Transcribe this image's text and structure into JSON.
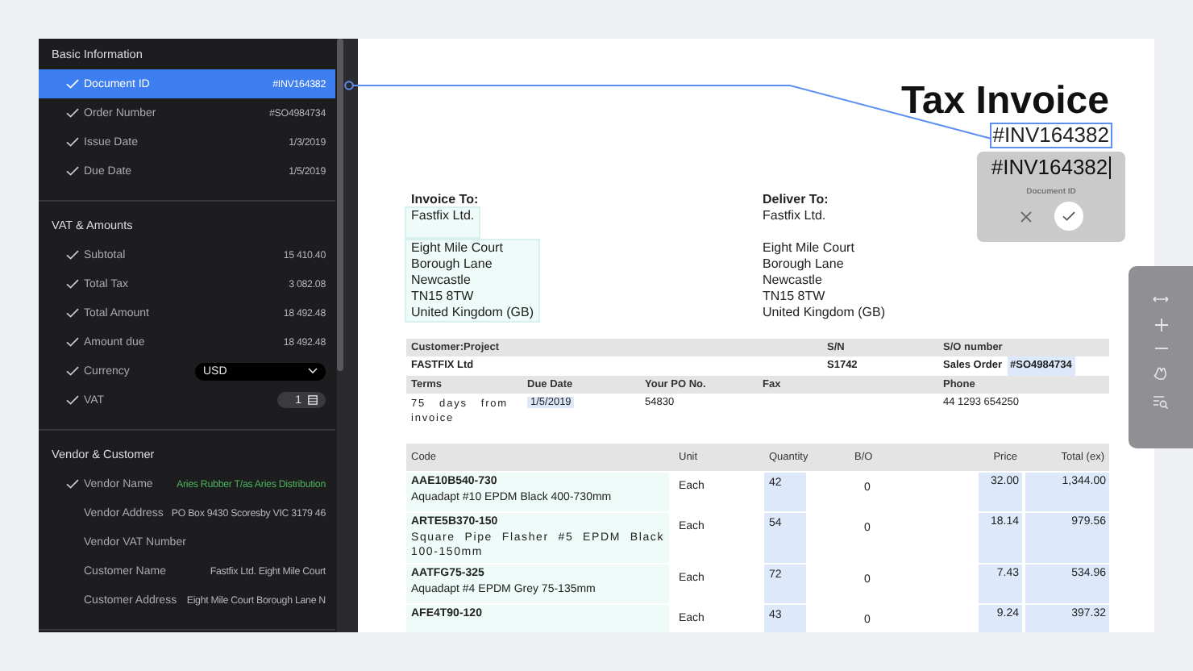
{
  "sidebar": {
    "sections": [
      {
        "title": "Basic Information",
        "fields": [
          {
            "kind": "text",
            "label": "Document ID",
            "value": "#INV164382",
            "checked": true,
            "selected": true,
            "matched": false
          },
          {
            "kind": "text",
            "label": "Order Number",
            "value": "#SO4984734",
            "checked": true,
            "selected": false,
            "matched": false
          },
          {
            "kind": "text",
            "label": "Issue Date",
            "value": "1/3/2019",
            "checked": true,
            "selected": false,
            "matched": false
          },
          {
            "kind": "text",
            "label": "Due Date",
            "value": "1/5/2019",
            "checked": true,
            "selected": false,
            "matched": false
          }
        ]
      },
      {
        "title": "VAT & Amounts",
        "fields": [
          {
            "kind": "text",
            "label": "Subtotal",
            "value": "15 410.40",
            "checked": true,
            "selected": false,
            "matched": false
          },
          {
            "kind": "text",
            "label": "Total Tax",
            "value": "3 082.08",
            "checked": true,
            "selected": false,
            "matched": false
          },
          {
            "kind": "text",
            "label": "Total Amount",
            "value": "18 492.48",
            "checked": true,
            "selected": false,
            "matched": false
          },
          {
            "kind": "text",
            "label": "Amount due",
            "value": "18 492.48",
            "checked": true,
            "selected": false,
            "matched": false
          },
          {
            "kind": "dropdown",
            "label": "Currency",
            "value": "USD",
            "checked": true,
            "selected": false,
            "matched": false
          },
          {
            "kind": "stepper",
            "label": "VAT",
            "value": "1",
            "checked": true,
            "selected": false,
            "matched": false
          }
        ]
      },
      {
        "title": "Vendor & Customer",
        "fields": [
          {
            "kind": "text",
            "label": "Vendor Name",
            "value": "Aries Rubber T/as Aries Distribution",
            "checked": true,
            "selected": false,
            "matched": true
          },
          {
            "kind": "text",
            "label": "Vendor Address",
            "value": "PO Box 9430 Scoresby VIC 3179 46",
            "checked": false,
            "selected": false,
            "matched": false
          },
          {
            "kind": "text",
            "label": "Vendor VAT Number",
            "checked": false,
            "selected": false,
            "matched": false
          },
          {
            "kind": "text",
            "label": "Customer Name",
            "value": "Fastfix Ltd. Eight Mile Court",
            "checked": false,
            "selected": false,
            "matched": false
          },
          {
            "kind": "text",
            "label": "Customer Address",
            "value": "Eight Mile Court Borough Lane N",
            "checked": false,
            "selected": false,
            "matched": false
          }
        ]
      }
    ]
  },
  "document": {
    "title": "Tax Invoice",
    "document_id": {
      "value": "#INV164382",
      "selected": true
    },
    "editor": {
      "value": "#INV164382",
      "label": "Document ID"
    },
    "addresses": [
      {
        "heading": "Invoice To:",
        "highlighted": true,
        "blocks": [
          [
            "Fastfix Ltd."
          ],
          [
            "Eight Mile Court",
            "Borough Lane",
            "Newcastle",
            "TN15 8TW",
            "United Kingdom (GB)"
          ]
        ]
      },
      {
        "heading": "Deliver To:",
        "highlighted": false,
        "blocks": [
          [
            "Fastfix Ltd."
          ],
          [
            "Eight Mile Court",
            "Borough Lane",
            "Newcastle",
            "TN15 8TW",
            "United Kingdom (GB)"
          ]
        ]
      }
    ],
    "order_info": {
      "customer_project": {
        "label": "Customer:Project",
        "value": "FASTFIX Ltd"
      },
      "sn": {
        "label": "S/N",
        "value": "S1742"
      },
      "so_number": {
        "label": "S/O number",
        "prefix": "Sales Order",
        "value": "#SO4984734"
      },
      "terms": {
        "label": "Terms",
        "value": "75 days from invoice"
      },
      "due_date": {
        "label": "Due Date",
        "value": "1/5/2019"
      },
      "po_number": {
        "label": "Your PO No.",
        "value": "54830"
      },
      "fax": {
        "label": "Fax"
      },
      "phone": {
        "label": "Phone",
        "value": "44 1293 654250"
      }
    },
    "line_items": {
      "columns": [
        "Code",
        "Unit",
        "Quantity",
        "B/O",
        "Price",
        "Total (ex)"
      ],
      "rows": [
        {
          "code": "AAE10B540-730",
          "description": "Aquadapt #10 EPDM Black 400-730mm",
          "unit": "Each",
          "quantity": "42",
          "bo": "0",
          "price": "32.00",
          "total": "1,344.00"
        },
        {
          "code": "ARTE5B370-150",
          "description": "Square Pipe Flasher #5 EPDM Black 100-150mm",
          "unit": "Each",
          "quantity": "54",
          "bo": "0",
          "price": "18.14",
          "total": "979.56"
        },
        {
          "code": "AATFG75-325",
          "description": "Aquadapt #4 EPDM Grey 75-135mm",
          "unit": "Each",
          "quantity": "72",
          "bo": "0",
          "price": "7.43",
          "total": "534.96"
        },
        {
          "code": "AFE4T90-120",
          "unit": "Each",
          "quantity": "43",
          "bo": "0",
          "price": "9.24",
          "total": "397.32"
        }
      ]
    }
  }
}
